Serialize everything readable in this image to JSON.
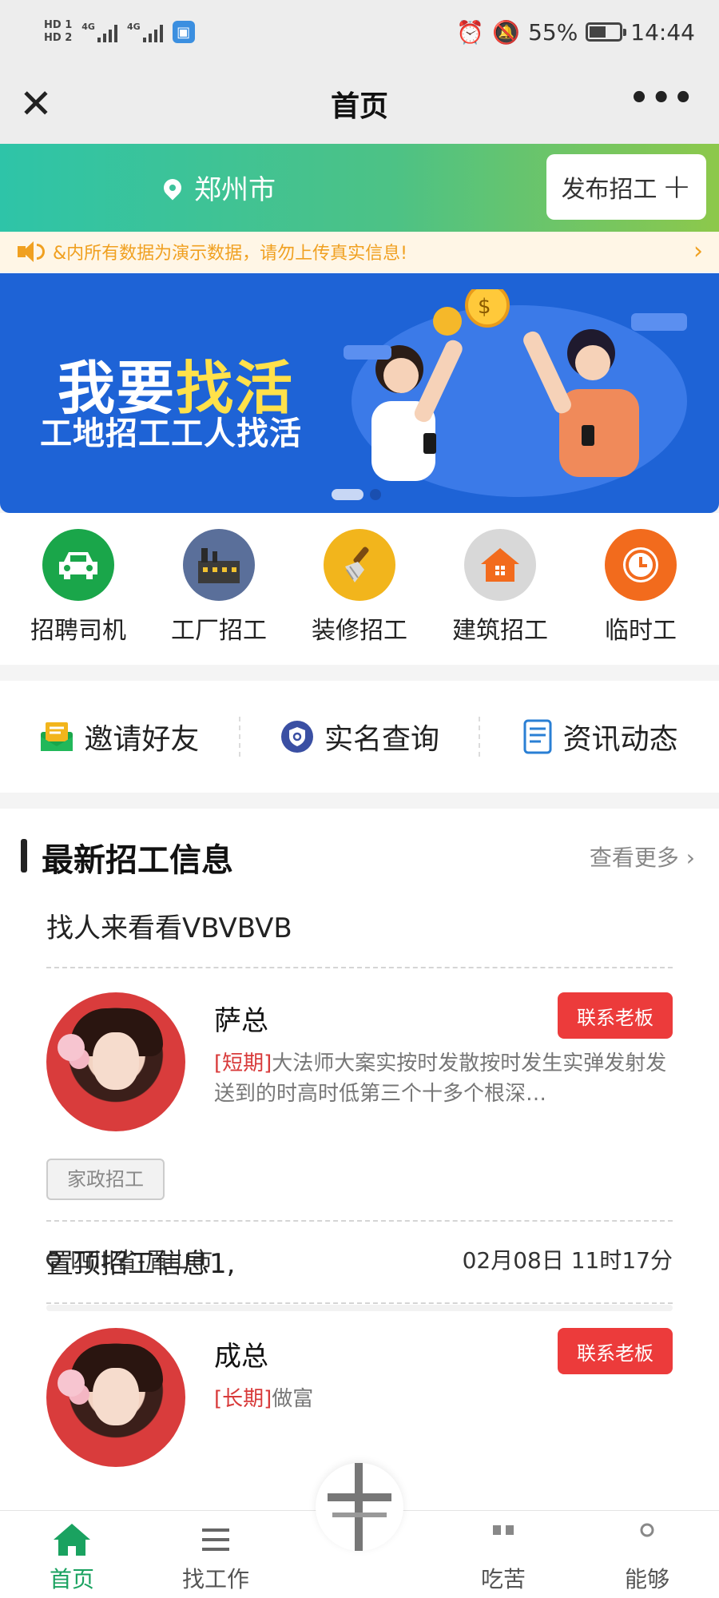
{
  "status_bar": {
    "hd1": "HD 1",
    "hd2": "HD 2",
    "net1": "4G",
    "net2": "4G",
    "battery_percent": "55%",
    "battery_level": 0.55,
    "time": "14:44"
  },
  "nav": {
    "title": "首页",
    "close_icon": "close-icon",
    "more_icon": "more-icon"
  },
  "city_bar": {
    "city": "郑州市",
    "publish_label": "发布招工"
  },
  "notice": {
    "text": "&内所有数据为演示数据，请勿上传真实信息!"
  },
  "banner": {
    "title_part1": "我要",
    "title_part2": "找活",
    "subtitle": "工地招工工人找活",
    "slides": 2,
    "active_slide": 1
  },
  "categories": [
    {
      "label": "招聘司机",
      "icon": "car-icon",
      "color": "#1aa64a"
    },
    {
      "label": "工厂招工",
      "icon": "factory-icon",
      "color": "#5a6f9a"
    },
    {
      "label": "装修招工",
      "icon": "brush-icon",
      "color": "#f2b51c"
    },
    {
      "label": "建筑招工",
      "icon": "house-icon",
      "color": "#d8d8d8"
    },
    {
      "label": "临时工",
      "icon": "clock-icon",
      "color": "#f26b1d"
    }
  ],
  "quick_links": [
    {
      "label": "邀请好友",
      "icon": "envelope-icon"
    },
    {
      "label": "实名查询",
      "icon": "shield-icon"
    },
    {
      "label": "资讯动态",
      "icon": "document-icon"
    }
  ],
  "section": {
    "title": "最新招工信息",
    "more": "查看更多"
  },
  "jobs": [
    {
      "title": "找人来看看VBVBVB",
      "boss": "萨总",
      "contact_label": "联系老板",
      "type": "[短期]",
      "description": "大法师大案实按时发散按时发生实弹发射发送到的时高时低第三个十多个根深…",
      "tag": "家政招工",
      "location": "四川省-眉山市",
      "time": "02月08日 11时17分"
    },
    {
      "title": "置顶招工信息1,",
      "boss": "成总",
      "contact_label": "联系老板",
      "type": "[长期]",
      "description": "做富"
    }
  ],
  "tabbar": {
    "home": "首页",
    "find_work": "找工作",
    "tab4": "吃苦",
    "tab5": "能够"
  },
  "colors": {
    "accent_green": "#1aa260",
    "contact_red": "#ec3b3b",
    "banner_blue": "#1e63d6",
    "notice_orange": "#f0a020"
  }
}
